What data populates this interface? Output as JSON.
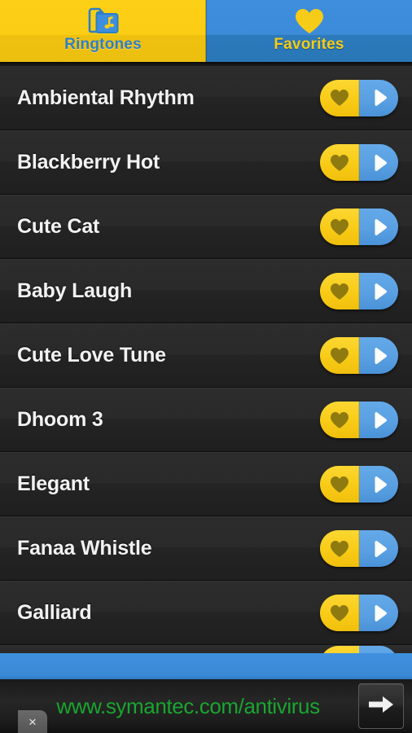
{
  "app": {
    "theme": {
      "tab_active_bg": "#fbcd14",
      "tab_inactive_bg": "#3c8bd9",
      "accent_yellow": "#f8cb16",
      "accent_blue": "#5aa0e2",
      "list_bg": "#2a2a2a",
      "row_text": "#f2f2f2",
      "ad_text_green": "#19a62f"
    }
  },
  "tabs": [
    {
      "id": "tab-ringtones",
      "label": "Ringtones",
      "icon": "music-folder-icon",
      "selected": true
    },
    {
      "id": "tab-favorites",
      "label": "Favorites",
      "icon": "heart-icon",
      "selected": false
    }
  ],
  "list": {
    "rows": [
      {
        "title": "Ambiental Rhythm",
        "favorite_icon": "heart-icon",
        "play_icon": "play-icon"
      },
      {
        "title": "Blackberry Hot",
        "favorite_icon": "heart-icon",
        "play_icon": "play-icon"
      },
      {
        "title": "Cute Cat",
        "favorite_icon": "heart-icon",
        "play_icon": "play-icon"
      },
      {
        "title": "Baby Laugh",
        "favorite_icon": "heart-icon",
        "play_icon": "play-icon"
      },
      {
        "title": "Cute Love Tune",
        "favorite_icon": "heart-icon",
        "play_icon": "play-icon"
      },
      {
        "title": "Dhoom 3",
        "favorite_icon": "heart-icon",
        "play_icon": "play-icon"
      },
      {
        "title": "Elegant",
        "favorite_icon": "heart-icon",
        "play_icon": "play-icon"
      },
      {
        "title": "Fanaa Whistle",
        "favorite_icon": "heart-icon",
        "play_icon": "play-icon"
      },
      {
        "title": "Galliard",
        "favorite_icon": "heart-icon",
        "play_icon": "play-icon"
      }
    ]
  },
  "ad": {
    "url_text": "www.symantec.com/antivirus",
    "arrow_icon": "arrow-right-icon",
    "close_label": "×"
  }
}
